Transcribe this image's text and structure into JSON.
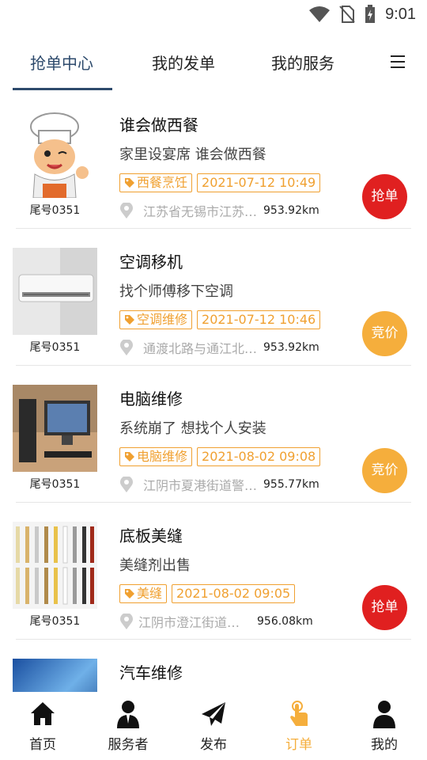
{
  "status_bar": {
    "time": "9:01"
  },
  "tabs": [
    {
      "label": "抢单中心",
      "active": true
    },
    {
      "label": "我的发单",
      "active": false
    },
    {
      "label": "我的服务",
      "active": false
    }
  ],
  "orders": [
    {
      "title": "谁会做西餐",
      "description": "家里设宴席 谁会做西餐",
      "category": "西餐烹饪",
      "time": "2021-07-12 10:49",
      "address": "江苏省无锡市江苏省无锡市",
      "distance": "953.92km",
      "tail": "尾号0351",
      "action": "抢单",
      "action_type": "grab"
    },
    {
      "title": "空调移机",
      "description": "找个师傅移下空调",
      "category": "空调维修",
      "time": "2021-07-12 10:46",
      "address": "通渡北路与通江北路交叉口",
      "distance": "953.92km",
      "tail": "尾号0351",
      "action": "竞价",
      "action_type": "bid"
    },
    {
      "title": "电脑维修",
      "description": "系统崩了 想找个人安装",
      "category": "电脑维修",
      "time": "2021-08-02 09:08",
      "address": "江阴市夏港街道警务室附近",
      "distance": "955.77km",
      "tail": "尾号0351",
      "action": "竞价",
      "action_type": "bid"
    },
    {
      "title": "底板美缝",
      "description": "美缝剂出售",
      "category": "美缝",
      "time": "2021-08-02 09:05",
      "address": "江阴市澄江街道附近小区",
      "distance": "956.08km",
      "tail": "尾号0351",
      "action": "抢单",
      "action_type": "grab"
    },
    {
      "title": "汽车维修",
      "description": "",
      "category": "",
      "time": "",
      "address": "",
      "distance": "",
      "tail": "",
      "action": "",
      "action_type": ""
    }
  ],
  "bottom_nav": [
    {
      "label": "首页",
      "icon": "home-icon",
      "active": false
    },
    {
      "label": "服务者",
      "icon": "worker-icon",
      "active": false
    },
    {
      "label": "发布",
      "icon": "send-icon",
      "active": false
    },
    {
      "label": "订单",
      "icon": "hand-tap-icon",
      "active": true
    },
    {
      "label": "我的",
      "icon": "user-icon",
      "active": false
    }
  ],
  "colors": {
    "accent": "#2d4a6c",
    "tag": "#f0a030",
    "grab": "#e02020",
    "bid": "#f5ae3c"
  }
}
